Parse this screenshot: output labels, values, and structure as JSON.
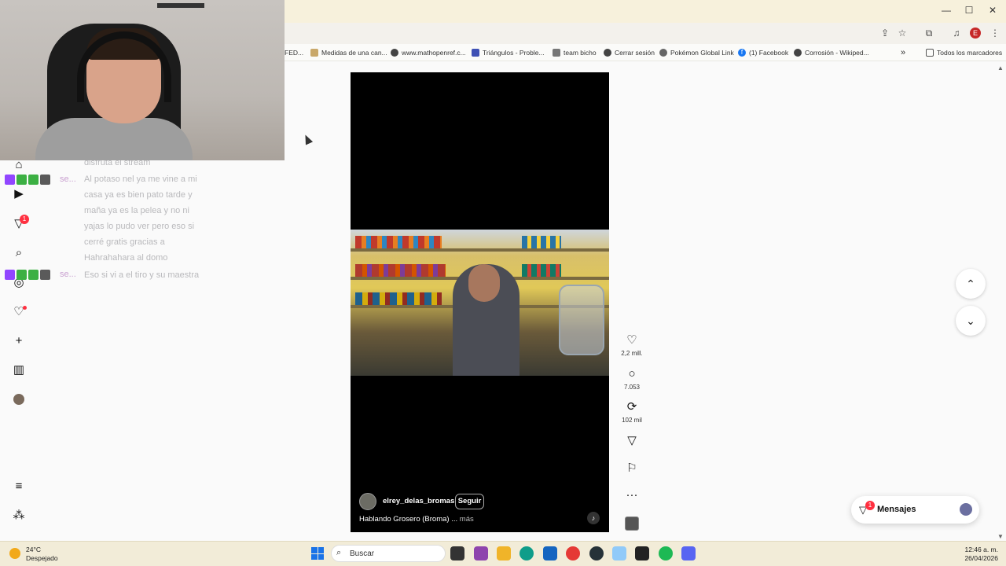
{
  "browser": {
    "window_controls": [
      "—",
      "☐",
      "✕"
    ],
    "profile_initial": "E",
    "bookmarks": [
      {
        "label": "FED...",
        "icon": "folder-icon"
      },
      {
        "label": "Medidas de una can...",
        "icon": "site-icon"
      },
      {
        "label": "www.mathopenref.c...",
        "icon": "site-icon"
      },
      {
        "label": "Triángulos - Proble...",
        "icon": "site-icon"
      },
      {
        "label": "team bicho",
        "icon": "site-icon"
      },
      {
        "label": "Cerrar sesión",
        "icon": "site-icon"
      },
      {
        "label": "Pokémon Global Link",
        "icon": "pokeball-icon"
      },
      {
        "label": "(1) Facebook",
        "icon": "facebook-icon"
      },
      {
        "label": "Corrosión - Wikiped...",
        "icon": "wikipedia-icon"
      }
    ],
    "bookmarks_overflow": "»",
    "all_bookmarks": "Todos los marcadores"
  },
  "chat_overlay": {
    "top_line": "disfruta el stream",
    "messages": [
      {
        "user": "se...",
        "lines": [
          "Al potaso nel ya me vine a mi",
          "casa ya es bien pato tarde y",
          "maña ya es la pelea y no ni",
          "yajas lo pudo ver pero eso si",
          "cerré gratis gracias a",
          "Hahrahahara al domo"
        ]
      },
      {
        "user": "se...",
        "lines": [
          "Eso si vi a el tiro y su maestra"
        ]
      }
    ]
  },
  "reel": {
    "username": "elrey_delas_bromas",
    "follow_label": "Seguir",
    "caption": "Hablando Grosero (Broma) ...",
    "more_label": "más"
  },
  "actions": {
    "likes": "2,2 mill.",
    "comments": "7.053",
    "reposts": "102 mil",
    "more_label": "···"
  },
  "messages": {
    "label": "Mensajes",
    "badge": "1"
  },
  "sidebar": {
    "notification_badge": "1"
  },
  "taskbar": {
    "temperature": "24°C",
    "weather": "Despejado",
    "search_label": "Buscar",
    "time": "12:46 a. m.",
    "date": "26/04/2026"
  },
  "colors": {
    "accent_red": "#ff3040",
    "reel_background": "#000000",
    "taskbar": "#f2ecd8"
  }
}
